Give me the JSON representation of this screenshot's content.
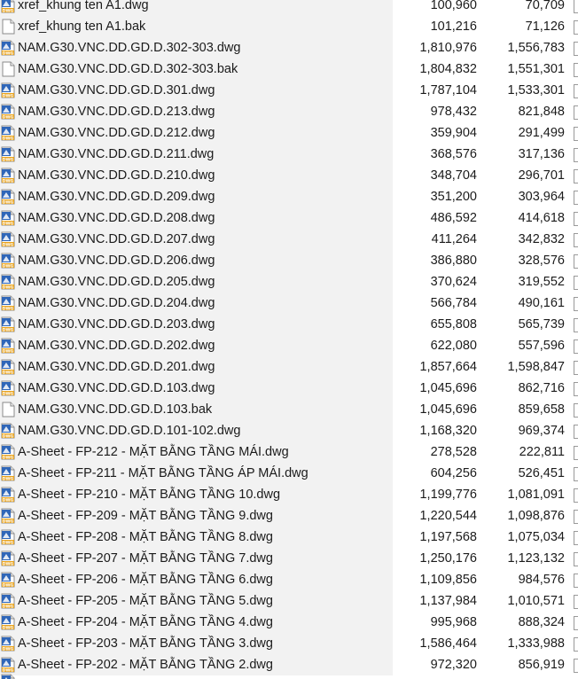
{
  "files": [
    {
      "name": "xref_khung ten A1.dwg",
      "icon": "dwg-file-icon",
      "size": "100,960",
      "compressed": "70,709"
    },
    {
      "name": "xref_khung ten A1.bak",
      "icon": "blank-file-icon",
      "size": "101,216",
      "compressed": "71,126"
    },
    {
      "name": "NAM.G30.VNC.DD.GD.D.302-303.dwg",
      "icon": "dwg-file-icon",
      "size": "1,810,976",
      "compressed": "1,556,783"
    },
    {
      "name": "NAM.G30.VNC.DD.GD.D.302-303.bak",
      "icon": "blank-file-icon",
      "size": "1,804,832",
      "compressed": "1,551,301"
    },
    {
      "name": "NAM.G30.VNC.DD.GD.D.301.dwg",
      "icon": "dwg-file-icon",
      "size": "1,787,104",
      "compressed": "1,533,301"
    },
    {
      "name": "NAM.G30.VNC.DD.GD.D.213.dwg",
      "icon": "dwg-file-icon",
      "size": "978,432",
      "compressed": "821,848"
    },
    {
      "name": "NAM.G30.VNC.DD.GD.D.212.dwg",
      "icon": "dwg-file-icon",
      "size": "359,904",
      "compressed": "291,499"
    },
    {
      "name": "NAM.G30.VNC.DD.GD.D.211.dwg",
      "icon": "dwg-file-icon",
      "size": "368,576",
      "compressed": "317,136"
    },
    {
      "name": "NAM.G30.VNC.DD.GD.D.210.dwg",
      "icon": "dwg-file-icon",
      "size": "348,704",
      "compressed": "296,701"
    },
    {
      "name": "NAM.G30.VNC.DD.GD.D.209.dwg",
      "icon": "dwg-file-icon",
      "size": "351,200",
      "compressed": "303,964"
    },
    {
      "name": "NAM.G30.VNC.DD.GD.D.208.dwg",
      "icon": "dwg-file-icon",
      "size": "486,592",
      "compressed": "414,618"
    },
    {
      "name": "NAM.G30.VNC.DD.GD.D.207.dwg",
      "icon": "dwg-file-icon",
      "size": "411,264",
      "compressed": "342,832"
    },
    {
      "name": "NAM.G30.VNC.DD.GD.D.206.dwg",
      "icon": "dwg-file-icon",
      "size": "386,880",
      "compressed": "328,576"
    },
    {
      "name": "NAM.G30.VNC.DD.GD.D.205.dwg",
      "icon": "dwg-file-icon",
      "size": "370,624",
      "compressed": "319,552"
    },
    {
      "name": "NAM.G30.VNC.DD.GD.D.204.dwg",
      "icon": "dwg-file-icon",
      "size": "566,784",
      "compressed": "490,161"
    },
    {
      "name": "NAM.G30.VNC.DD.GD.D.203.dwg",
      "icon": "dwg-file-icon",
      "size": "655,808",
      "compressed": "565,739"
    },
    {
      "name": "NAM.G30.VNC.DD.GD.D.202.dwg",
      "icon": "dwg-file-icon",
      "size": "622,080",
      "compressed": "557,596"
    },
    {
      "name": "NAM.G30.VNC.DD.GD.D.201.dwg",
      "icon": "dwg-file-icon",
      "size": "1,857,664",
      "compressed": "1,598,847"
    },
    {
      "name": "NAM.G30.VNC.DD.GD.D.103.dwg",
      "icon": "dwg-file-icon",
      "size": "1,045,696",
      "compressed": "862,716"
    },
    {
      "name": "NAM.G30.VNC.DD.GD.D.103.bak",
      "icon": "blank-file-icon",
      "size": "1,045,696",
      "compressed": "859,658"
    },
    {
      "name": "NAM.G30.VNC.DD.GD.D.101-102.dwg",
      "icon": "dwg-file-icon",
      "size": "1,168,320",
      "compressed": "969,374"
    },
    {
      "name": "A-Sheet - FP-212 - MẶT BẰNG TẦNG MÁI.dwg",
      "icon": "dwg-file-icon",
      "size": "278,528",
      "compressed": "222,811"
    },
    {
      "name": "A-Sheet - FP-211 - MẶT BẰNG TẦNG ÁP MÁI.dwg",
      "icon": "dwg-file-icon",
      "size": "604,256",
      "compressed": "526,451"
    },
    {
      "name": "A-Sheet - FP-210 - MẶT BẰNG TẦNG 10.dwg",
      "icon": "dwg-file-icon",
      "size": "1,199,776",
      "compressed": "1,081,091"
    },
    {
      "name": "A-Sheet - FP-209 - MẶT BẰNG TẦNG 9.dwg",
      "icon": "dwg-file-icon",
      "size": "1,220,544",
      "compressed": "1,098,876"
    },
    {
      "name": "A-Sheet - FP-208 - MẶT BẰNG TẦNG 8.dwg",
      "icon": "dwg-file-icon",
      "size": "1,197,568",
      "compressed": "1,075,034"
    },
    {
      "name": "A-Sheet - FP-207 - MẶT BẰNG TẦNG 7.dwg",
      "icon": "dwg-file-icon",
      "size": "1,250,176",
      "compressed": "1,123,132"
    },
    {
      "name": "A-Sheet - FP-206 - MẶT BẰNG TẦNG 6.dwg",
      "icon": "dwg-file-icon",
      "size": "1,109,856",
      "compressed": "984,576"
    },
    {
      "name": "A-Sheet - FP-205 - MẶT BẰNG TẦNG 5.dwg",
      "icon": "dwg-file-icon",
      "size": "1,137,984",
      "compressed": "1,010,571"
    },
    {
      "name": "A-Sheet - FP-204 - MẶT BẰNG TẦNG 4.dwg",
      "icon": "dwg-file-icon",
      "size": "995,968",
      "compressed": "888,324"
    },
    {
      "name": "A-Sheet - FP-203 - MẶT BẰNG TẦNG 3.dwg",
      "icon": "dwg-file-icon",
      "size": "1,586,464",
      "compressed": "1,333,988"
    },
    {
      "name": "A-Sheet - FP-202 - MẶT BẰNG TẦNG 2.dwg",
      "icon": "dwg-file-icon",
      "size": "972,320",
      "compressed": "856,919"
    }
  ],
  "colors": {
    "selected_row_bg": "#f2f2f2",
    "dwg_icon_blue": "#2f66b8",
    "dwg_icon_orange": "#e8a21c",
    "text": "#1b1b1b"
  }
}
